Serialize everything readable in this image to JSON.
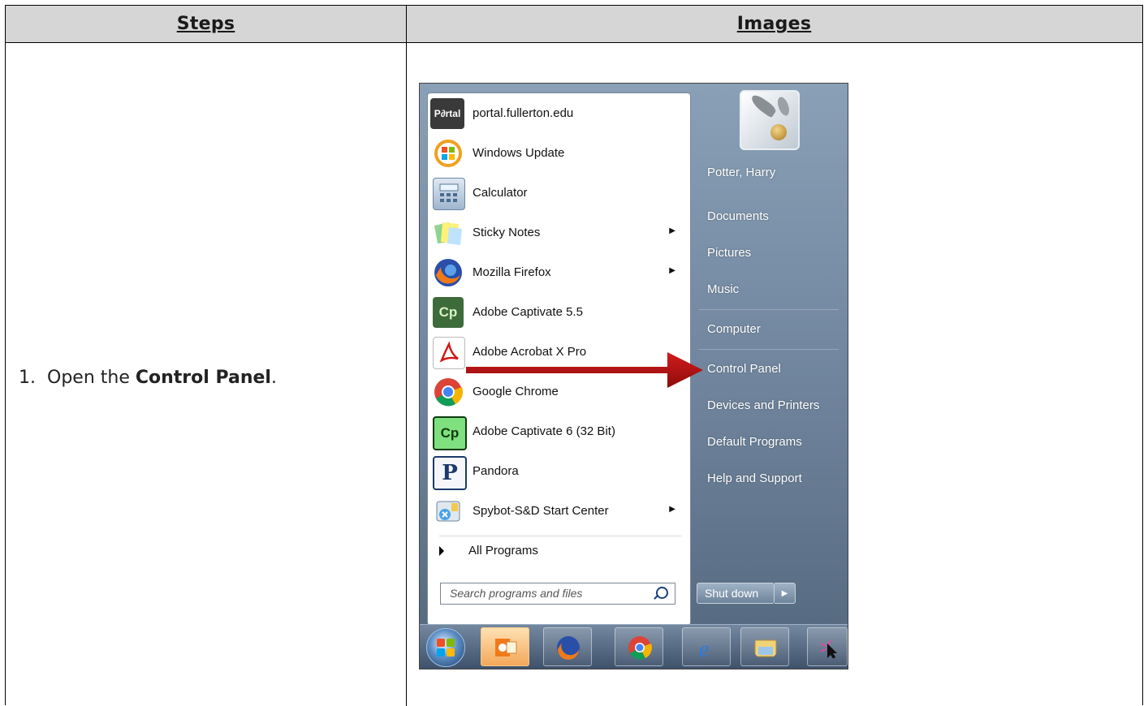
{
  "table": {
    "headers": {
      "steps": "Steps",
      "images": "Images"
    },
    "step": {
      "number": "1.",
      "prefix": "Open the ",
      "bold": "Control Panel",
      "suffix": "."
    }
  },
  "start_menu": {
    "programs": [
      {
        "label": "portal.fullerton.edu",
        "icon": "portal-icon",
        "submenu": false
      },
      {
        "label": "Windows Update",
        "icon": "windows-update-icon",
        "submenu": false
      },
      {
        "label": "Calculator",
        "icon": "calculator-icon",
        "submenu": false
      },
      {
        "label": "Sticky Notes",
        "icon": "sticky-notes-icon",
        "submenu": true
      },
      {
        "label": "Mozilla Firefox",
        "icon": "firefox-icon",
        "submenu": true
      },
      {
        "label": "Adobe Captivate 5.5",
        "icon": "captivate-icon",
        "submenu": false
      },
      {
        "label": "Adobe Acrobat X Pro",
        "icon": "acrobat-icon",
        "submenu": false
      },
      {
        "label": "Google Chrome",
        "icon": "chrome-icon",
        "submenu": false
      },
      {
        "label": "Adobe Captivate 6 (32 Bit)",
        "icon": "captivate-icon",
        "submenu": false
      },
      {
        "label": "Pandora",
        "icon": "pandora-icon",
        "submenu": false
      },
      {
        "label": "Spybot-S&D Start Center",
        "icon": "spybot-icon",
        "submenu": true
      }
    ],
    "icon_text": {
      "portal": "P∂rtal",
      "captivate": "Cp",
      "pandora": "P"
    },
    "all_programs": "All Programs",
    "search_placeholder": "Search programs and files",
    "right_items": {
      "user": "Potter, Harry",
      "documents": "Documents",
      "pictures": "Pictures",
      "music": "Music",
      "computer": "Computer",
      "control_panel": "Control Panel",
      "devices": "Devices and Printers",
      "default_programs": "Default Programs",
      "help": "Help and Support"
    },
    "shutdown": "Shut down",
    "taskbar": [
      "outlook-icon",
      "firefox-icon",
      "chrome-icon",
      "internet-explorer-icon",
      "file-explorer-icon",
      "snipping-icon"
    ]
  }
}
